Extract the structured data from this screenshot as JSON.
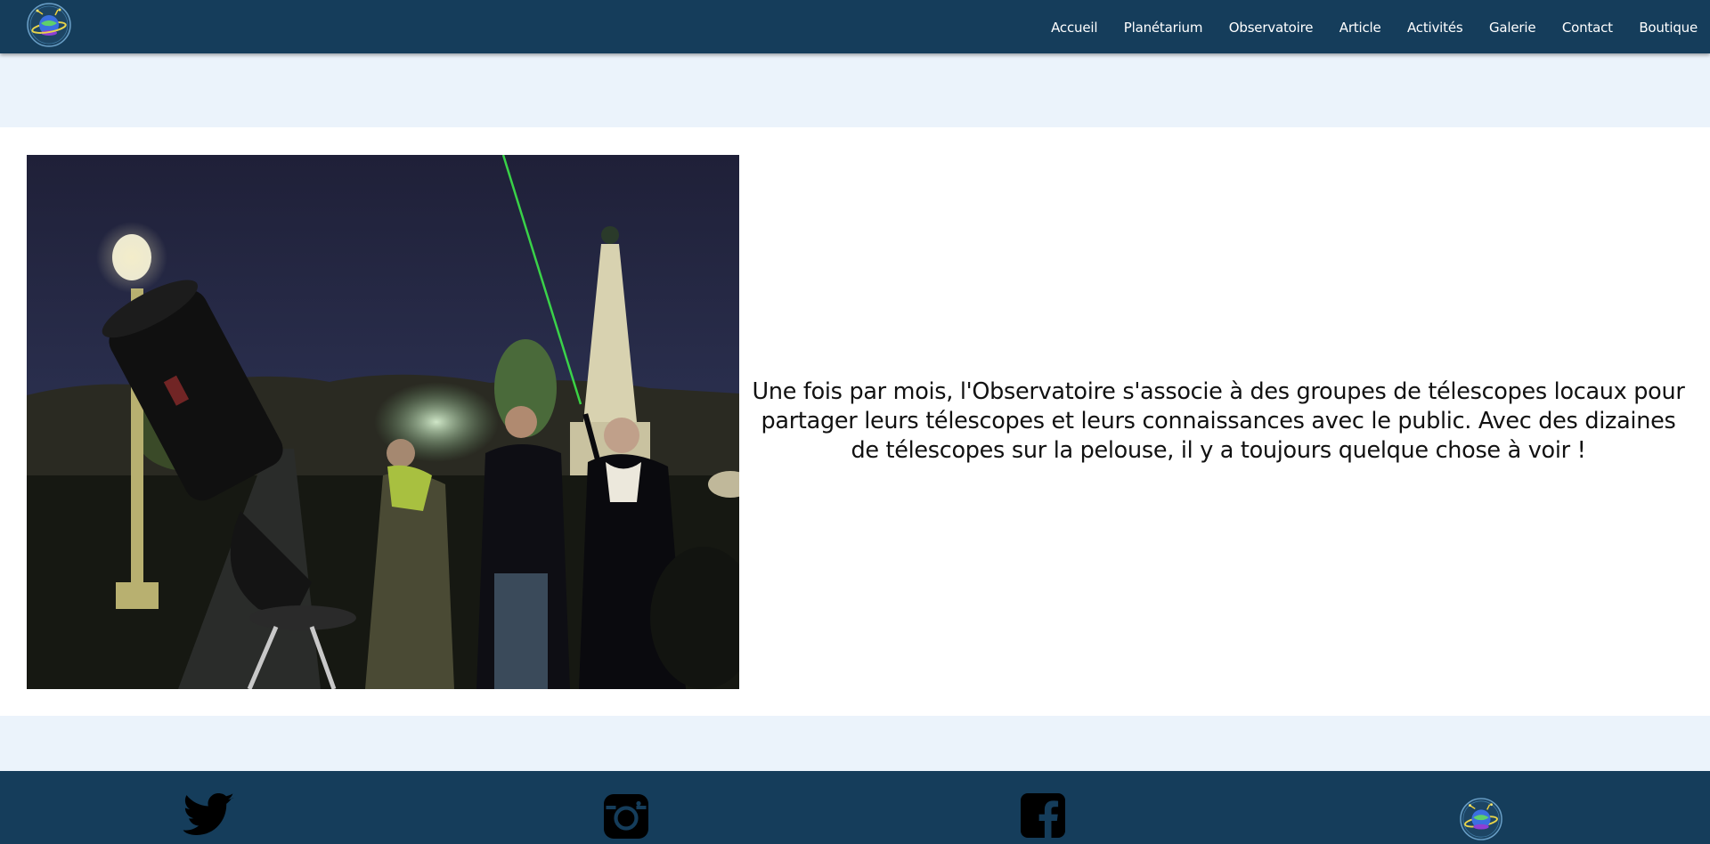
{
  "header": {
    "logo_icon": "planet-logo-icon",
    "nav": [
      {
        "label": "Accueil"
      },
      {
        "label": "Planétarium"
      },
      {
        "label": "Observatoire"
      },
      {
        "label": "Article"
      },
      {
        "label": "Activités"
      },
      {
        "label": "Galerie"
      },
      {
        "label": "Contact"
      },
      {
        "label": "Boutique"
      }
    ]
  },
  "main": {
    "photo_icon": "telescope-night-photo",
    "description": "Une fois par mois, l'Observatoire s'associe à des groupes de télescopes locaux pour partager leurs télescopes et leurs connaissances avec le public. Avec des dizaines de télescopes sur la pelouse, il y a toujours quelque chose à voir !"
  },
  "footer": {
    "social": [
      {
        "icon": "twitter-icon"
      },
      {
        "icon": "instagram-icon"
      },
      {
        "icon": "facebook-icon"
      }
    ],
    "logo_icon": "planet-logo-icon"
  },
  "colors": {
    "nav_bg": "#153d5b",
    "band_bg": "#ebf3fb",
    "section_bg": "#ffffff",
    "text": "#111111"
  }
}
